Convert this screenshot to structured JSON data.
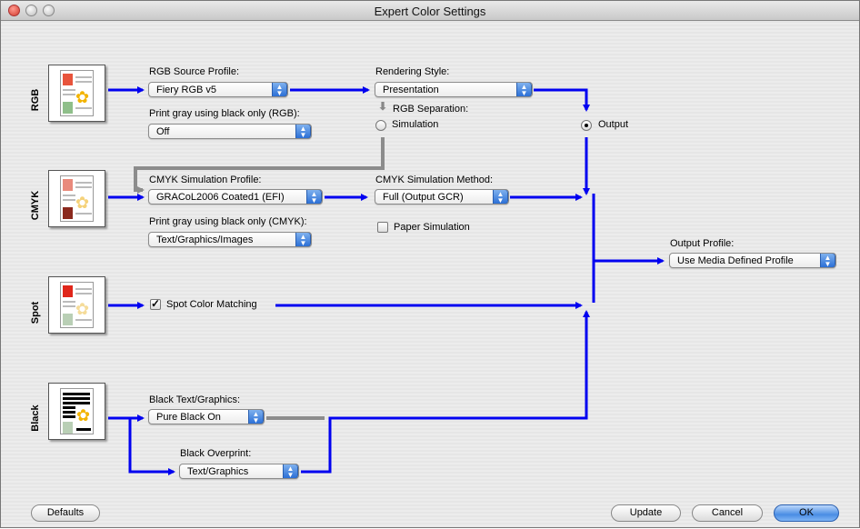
{
  "window": {
    "title": "Expert Color Settings"
  },
  "rows": {
    "rgb": {
      "label": "RGB"
    },
    "cmyk": {
      "label": "CMYK"
    },
    "spot": {
      "label": "Spot"
    },
    "black": {
      "label": "Black"
    }
  },
  "rgb": {
    "source_profile_label": "RGB Source Profile:",
    "source_profile_value": "Fiery RGB v5",
    "gray_label": "Print gray using black only (RGB):",
    "gray_value": "Off",
    "rendering_label": "Rendering Style:",
    "rendering_value": "Presentation",
    "separation_label": "RGB Separation:",
    "separation_options": {
      "simulation": "Simulation",
      "output": "Output"
    },
    "separation_selected": "Output"
  },
  "cmyk": {
    "sim_profile_label": "CMYK Simulation Profile:",
    "sim_profile_value": "GRACoL2006 Coated1 (EFI)",
    "gray_label": "Print gray using black only (CMYK):",
    "gray_value": "Text/Graphics/Images",
    "sim_method_label": "CMYK Simulation Method:",
    "sim_method_value": "Full (Output GCR)",
    "paper_sim_label": "Paper Simulation",
    "paper_sim_checked": false
  },
  "spot": {
    "matching_label": "Spot Color Matching",
    "matching_checked": true
  },
  "black": {
    "text_graphics_label": "Black Text/Graphics:",
    "text_graphics_value": "Pure Black On",
    "overprint_label": "Black Overprint:",
    "overprint_value": "Text/Graphics"
  },
  "output": {
    "profile_label": "Output Profile:",
    "profile_value": "Use Media Defined Profile"
  },
  "buttons": {
    "defaults": "Defaults",
    "update": "Update",
    "cancel": "Cancel",
    "ok": "OK"
  },
  "colors": {
    "flow_blue": "#0000f0",
    "flow_gray": "#8c8c8c",
    "accent_button": "#4a8de4"
  }
}
